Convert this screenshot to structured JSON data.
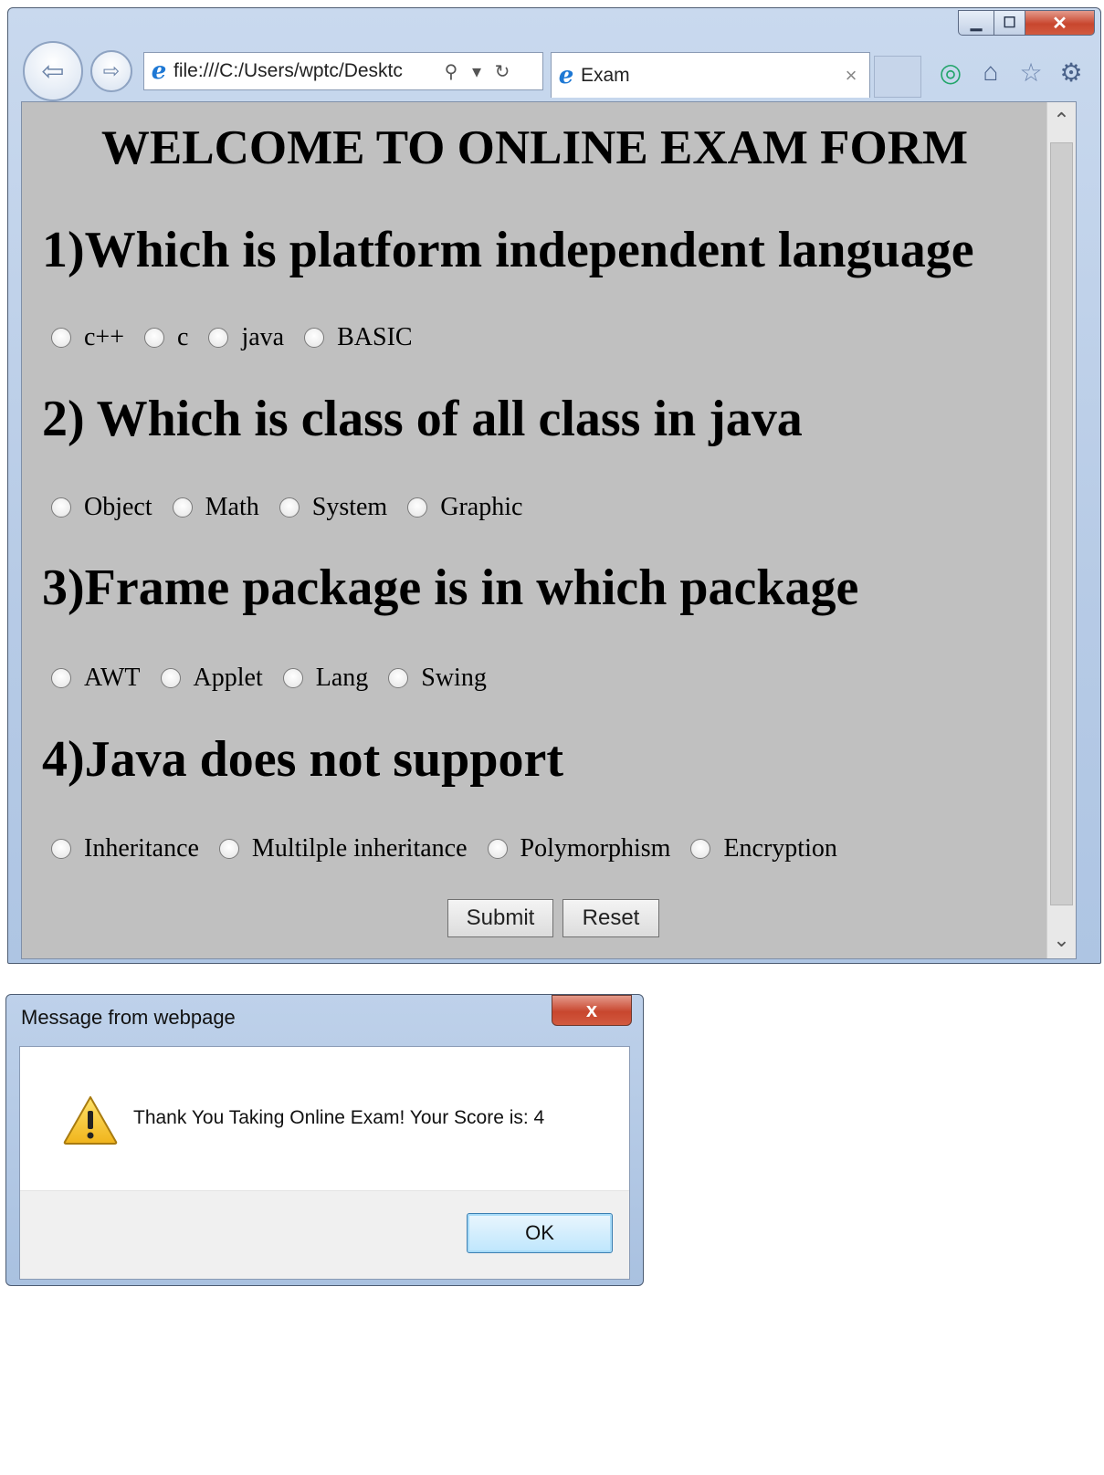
{
  "browser": {
    "address": "file:///C:/Users/wptc/Desktc",
    "tab_title": "Exam",
    "window_controls": {
      "minimize": "▁",
      "maximize": "☐",
      "close": "✕"
    },
    "icons": [
      "back-arrow-icon",
      "forward-arrow-icon",
      "ie-logo-icon",
      "search-icon",
      "dropdown-icon",
      "refresh-icon",
      "close-icon",
      "addon-icon",
      "home-icon",
      "favorites-star-icon",
      "settings-gear-icon"
    ]
  },
  "page": {
    "title": "WELCOME TO ONLINE EXAM FORM",
    "questions": [
      {
        "text": "1)Which is platform independent language",
        "options": [
          "c++",
          "c",
          "java",
          "BASIC"
        ]
      },
      {
        "text": "2) Which is class of all class in java",
        "options": [
          "Object",
          "Math",
          "System",
          "Graphic"
        ]
      },
      {
        "text": "3)Frame package is in which package",
        "options": [
          "AWT",
          "Applet",
          "Lang",
          "Swing"
        ]
      },
      {
        "text": "4)Java does not support",
        "options": [
          "Inheritance",
          "Multilple inheritance",
          "Polymorphism",
          "Encryption"
        ]
      }
    ],
    "submit_label": "Submit",
    "reset_label": "Reset"
  },
  "dialog": {
    "title": "Message from webpage",
    "message": "Thank You Taking Online Exam! Your Score is: 4",
    "ok_label": "OK",
    "icon": "warning-icon",
    "close_glyph": "x"
  },
  "colors": {
    "page_background": "#c0c0c0",
    "close_button": "#c8462e",
    "ie_blue": "#1e78d4"
  }
}
